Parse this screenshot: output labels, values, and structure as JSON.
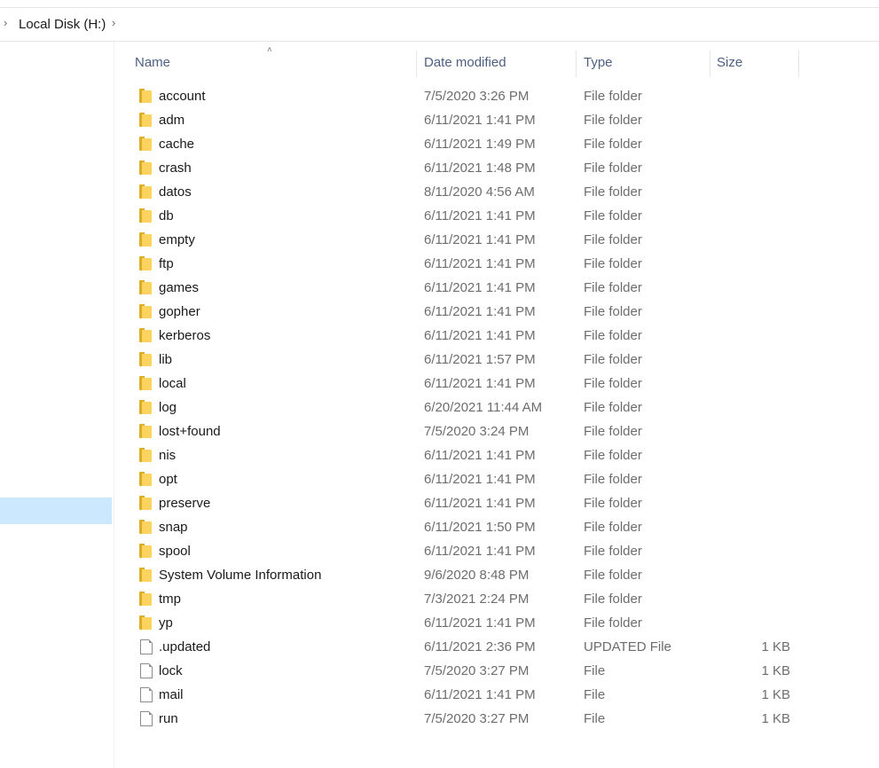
{
  "address_bar": {
    "location": "Local Disk (H:)"
  },
  "columns": {
    "name": "Name",
    "date": "Date modified",
    "type": "Type",
    "size": "Size"
  },
  "icons": {
    "folder": "folder-icon",
    "file": "file-icon",
    "chevron": "chevron-right-icon",
    "sort": "sort-up-icon"
  },
  "files": [
    {
      "name": "account",
      "date": "7/5/2020 3:26 PM",
      "type": "File folder",
      "size": "",
      "kind": "folder"
    },
    {
      "name": "adm",
      "date": "6/11/2021 1:41 PM",
      "type": "File folder",
      "size": "",
      "kind": "folder"
    },
    {
      "name": "cache",
      "date": "6/11/2021 1:49 PM",
      "type": "File folder",
      "size": "",
      "kind": "folder"
    },
    {
      "name": "crash",
      "date": "6/11/2021 1:48 PM",
      "type": "File folder",
      "size": "",
      "kind": "folder"
    },
    {
      "name": "datos",
      "date": "8/11/2020 4:56 AM",
      "type": "File folder",
      "size": "",
      "kind": "folder"
    },
    {
      "name": "db",
      "date": "6/11/2021 1:41 PM",
      "type": "File folder",
      "size": "",
      "kind": "folder"
    },
    {
      "name": "empty",
      "date": "6/11/2021 1:41 PM",
      "type": "File folder",
      "size": "",
      "kind": "folder"
    },
    {
      "name": "ftp",
      "date": "6/11/2021 1:41 PM",
      "type": "File folder",
      "size": "",
      "kind": "folder"
    },
    {
      "name": "games",
      "date": "6/11/2021 1:41 PM",
      "type": "File folder",
      "size": "",
      "kind": "folder"
    },
    {
      "name": "gopher",
      "date": "6/11/2021 1:41 PM",
      "type": "File folder",
      "size": "",
      "kind": "folder"
    },
    {
      "name": "kerberos",
      "date": "6/11/2021 1:41 PM",
      "type": "File folder",
      "size": "",
      "kind": "folder"
    },
    {
      "name": "lib",
      "date": "6/11/2021 1:57 PM",
      "type": "File folder",
      "size": "",
      "kind": "folder"
    },
    {
      "name": "local",
      "date": "6/11/2021 1:41 PM",
      "type": "File folder",
      "size": "",
      "kind": "folder"
    },
    {
      "name": "log",
      "date": "6/20/2021 11:44 AM",
      "type": "File folder",
      "size": "",
      "kind": "folder"
    },
    {
      "name": "lost+found",
      "date": "7/5/2020 3:24 PM",
      "type": "File folder",
      "size": "",
      "kind": "folder"
    },
    {
      "name": "nis",
      "date": "6/11/2021 1:41 PM",
      "type": "File folder",
      "size": "",
      "kind": "folder"
    },
    {
      "name": "opt",
      "date": "6/11/2021 1:41 PM",
      "type": "File folder",
      "size": "",
      "kind": "folder"
    },
    {
      "name": "preserve",
      "date": "6/11/2021 1:41 PM",
      "type": "File folder",
      "size": "",
      "kind": "folder"
    },
    {
      "name": "snap",
      "date": "6/11/2021 1:50 PM",
      "type": "File folder",
      "size": "",
      "kind": "folder"
    },
    {
      "name": "spool",
      "date": "6/11/2021 1:41 PM",
      "type": "File folder",
      "size": "",
      "kind": "folder"
    },
    {
      "name": "System Volume Information",
      "date": "9/6/2020 8:48 PM",
      "type": "File folder",
      "size": "",
      "kind": "folder"
    },
    {
      "name": "tmp",
      "date": "7/3/2021 2:24 PM",
      "type": "File folder",
      "size": "",
      "kind": "folder"
    },
    {
      "name": "yp",
      "date": "6/11/2021 1:41 PM",
      "type": "File folder",
      "size": "",
      "kind": "folder"
    },
    {
      "name": ".updated",
      "date": "6/11/2021 2:36 PM",
      "type": "UPDATED File",
      "size": "1 KB",
      "kind": "file"
    },
    {
      "name": "lock",
      "date": "7/5/2020 3:27 PM",
      "type": "File",
      "size": "1 KB",
      "kind": "file"
    },
    {
      "name": "mail",
      "date": "6/11/2021 1:41 PM",
      "type": "File",
      "size": "1 KB",
      "kind": "file"
    },
    {
      "name": "run",
      "date": "7/5/2020 3:27 PM",
      "type": "File",
      "size": "1 KB",
      "kind": "file"
    }
  ]
}
